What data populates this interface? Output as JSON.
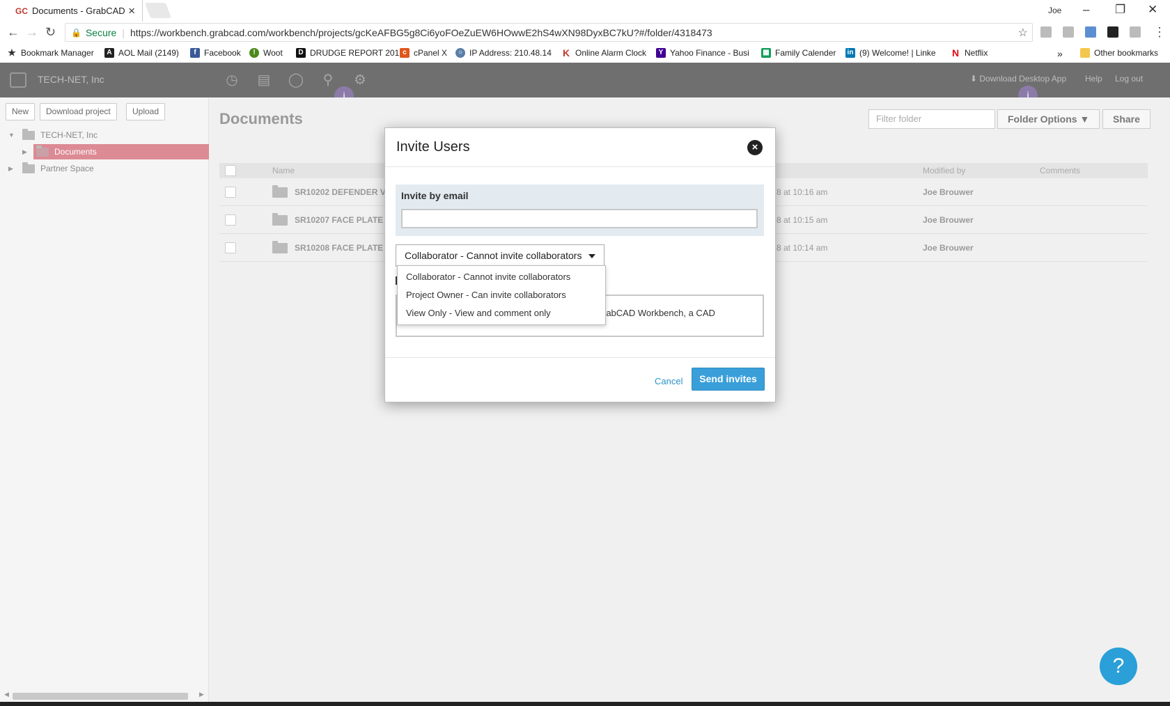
{
  "browser": {
    "tab_favicon": "GC",
    "tab_title": "Documents - GrabCAD",
    "profile_name": "Joe",
    "secure_label": "Secure",
    "url": "https://workbench.grabcad.com/workbench/projects/gcKeAFBG5g8Ci6yoFOeZuEW6HOwwE2hS4wXN98DyxBC7kU?#/folder/4318473",
    "bookmarks": [
      "Bookmark Manager",
      "AOL Mail (2149)",
      "Facebook",
      "Woot",
      "DRUDGE REPORT 201",
      "cPanel X",
      "IP Address: 210.48.14",
      "Online Alarm Clock",
      "Yahoo Finance - Busi",
      "Family Calender",
      "(9) Welcome! | Linke",
      "Netflix"
    ],
    "bookmarks_more": "»",
    "other_bookmarks": "Other bookmarks"
  },
  "app": {
    "company": "TECH-NET, Inc",
    "download_desktop": "Download Desktop App",
    "help": "Help",
    "logout": "Log out",
    "sidebar_buttons": [
      "New",
      "Download project",
      "Upload"
    ],
    "tree": {
      "root": "TECH-NET, Inc",
      "documents": "Documents",
      "partner": "Partner Space"
    },
    "main": {
      "title": "Documents",
      "filter_placeholder": "Filter folder",
      "folder_options": "Folder Options",
      "share": "Share",
      "columns": {
        "name": "Name",
        "modified_by": "Modified by",
        "comments": "Comments"
      },
      "rows": [
        {
          "name": "SR10202 DEFENDER V",
          "date": "8 at 10:16 am",
          "by": "Joe Brouwer"
        },
        {
          "name": "SR10207 FACE PLATE",
          "date": "8 at 10:15 am",
          "by": "Joe Brouwer"
        },
        {
          "name": "SR10208 FACE PLATE",
          "date": "8 at 10:14 am",
          "by": "Joe Brouwer"
        }
      ]
    }
  },
  "modal": {
    "title": "Invite Users",
    "invite_label": "Invite by email",
    "email_value": "",
    "role_selected": "Collaborator - Cannot invite collaborators",
    "role_options": [
      "Collaborator - Cannot invite collaborators",
      "Project Owner - Can invite collaborators",
      "View Only - View and comment only"
    ],
    "message_visible": "rabCAD Workbench, a CAD",
    "cancel": "Cancel",
    "send": "Send invites"
  },
  "help_glyph": "?",
  "info_glyph": "i",
  "colors": {
    "topbar": "#6f6f6f",
    "selected_folder": "#dc8a94",
    "primary_button": "#3a9fd9",
    "link": "#2a93c9"
  }
}
